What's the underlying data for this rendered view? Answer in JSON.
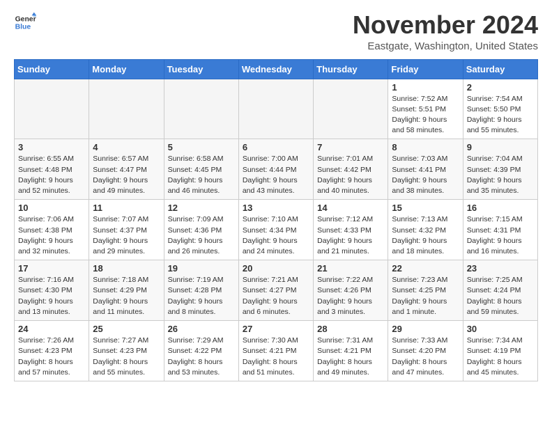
{
  "header": {
    "logo_general": "General",
    "logo_blue": "Blue",
    "month_title": "November 2024",
    "location": "Eastgate, Washington, United States"
  },
  "days_of_week": [
    "Sunday",
    "Monday",
    "Tuesday",
    "Wednesday",
    "Thursday",
    "Friday",
    "Saturday"
  ],
  "weeks": [
    [
      {
        "day": "",
        "detail": ""
      },
      {
        "day": "",
        "detail": ""
      },
      {
        "day": "",
        "detail": ""
      },
      {
        "day": "",
        "detail": ""
      },
      {
        "day": "",
        "detail": ""
      },
      {
        "day": "1",
        "detail": "Sunrise: 7:52 AM\nSunset: 5:51 PM\nDaylight: 9 hours and 58 minutes."
      },
      {
        "day": "2",
        "detail": "Sunrise: 7:54 AM\nSunset: 5:50 PM\nDaylight: 9 hours and 55 minutes."
      }
    ],
    [
      {
        "day": "3",
        "detail": "Sunrise: 6:55 AM\nSunset: 4:48 PM\nDaylight: 9 hours and 52 minutes."
      },
      {
        "day": "4",
        "detail": "Sunrise: 6:57 AM\nSunset: 4:47 PM\nDaylight: 9 hours and 49 minutes."
      },
      {
        "day": "5",
        "detail": "Sunrise: 6:58 AM\nSunset: 4:45 PM\nDaylight: 9 hours and 46 minutes."
      },
      {
        "day": "6",
        "detail": "Sunrise: 7:00 AM\nSunset: 4:44 PM\nDaylight: 9 hours and 43 minutes."
      },
      {
        "day": "7",
        "detail": "Sunrise: 7:01 AM\nSunset: 4:42 PM\nDaylight: 9 hours and 40 minutes."
      },
      {
        "day": "8",
        "detail": "Sunrise: 7:03 AM\nSunset: 4:41 PM\nDaylight: 9 hours and 38 minutes."
      },
      {
        "day": "9",
        "detail": "Sunrise: 7:04 AM\nSunset: 4:39 PM\nDaylight: 9 hours and 35 minutes."
      }
    ],
    [
      {
        "day": "10",
        "detail": "Sunrise: 7:06 AM\nSunset: 4:38 PM\nDaylight: 9 hours and 32 minutes."
      },
      {
        "day": "11",
        "detail": "Sunrise: 7:07 AM\nSunset: 4:37 PM\nDaylight: 9 hours and 29 minutes."
      },
      {
        "day": "12",
        "detail": "Sunrise: 7:09 AM\nSunset: 4:36 PM\nDaylight: 9 hours and 26 minutes."
      },
      {
        "day": "13",
        "detail": "Sunrise: 7:10 AM\nSunset: 4:34 PM\nDaylight: 9 hours and 24 minutes."
      },
      {
        "day": "14",
        "detail": "Sunrise: 7:12 AM\nSunset: 4:33 PM\nDaylight: 9 hours and 21 minutes."
      },
      {
        "day": "15",
        "detail": "Sunrise: 7:13 AM\nSunset: 4:32 PM\nDaylight: 9 hours and 18 minutes."
      },
      {
        "day": "16",
        "detail": "Sunrise: 7:15 AM\nSunset: 4:31 PM\nDaylight: 9 hours and 16 minutes."
      }
    ],
    [
      {
        "day": "17",
        "detail": "Sunrise: 7:16 AM\nSunset: 4:30 PM\nDaylight: 9 hours and 13 minutes."
      },
      {
        "day": "18",
        "detail": "Sunrise: 7:18 AM\nSunset: 4:29 PM\nDaylight: 9 hours and 11 minutes."
      },
      {
        "day": "19",
        "detail": "Sunrise: 7:19 AM\nSunset: 4:28 PM\nDaylight: 9 hours and 8 minutes."
      },
      {
        "day": "20",
        "detail": "Sunrise: 7:21 AM\nSunset: 4:27 PM\nDaylight: 9 hours and 6 minutes."
      },
      {
        "day": "21",
        "detail": "Sunrise: 7:22 AM\nSunset: 4:26 PM\nDaylight: 9 hours and 3 minutes."
      },
      {
        "day": "22",
        "detail": "Sunrise: 7:23 AM\nSunset: 4:25 PM\nDaylight: 9 hours and 1 minute."
      },
      {
        "day": "23",
        "detail": "Sunrise: 7:25 AM\nSunset: 4:24 PM\nDaylight: 8 hours and 59 minutes."
      }
    ],
    [
      {
        "day": "24",
        "detail": "Sunrise: 7:26 AM\nSunset: 4:23 PM\nDaylight: 8 hours and 57 minutes."
      },
      {
        "day": "25",
        "detail": "Sunrise: 7:27 AM\nSunset: 4:23 PM\nDaylight: 8 hours and 55 minutes."
      },
      {
        "day": "26",
        "detail": "Sunrise: 7:29 AM\nSunset: 4:22 PM\nDaylight: 8 hours and 53 minutes."
      },
      {
        "day": "27",
        "detail": "Sunrise: 7:30 AM\nSunset: 4:21 PM\nDaylight: 8 hours and 51 minutes."
      },
      {
        "day": "28",
        "detail": "Sunrise: 7:31 AM\nSunset: 4:21 PM\nDaylight: 8 hours and 49 minutes."
      },
      {
        "day": "29",
        "detail": "Sunrise: 7:33 AM\nSunset: 4:20 PM\nDaylight: 8 hours and 47 minutes."
      },
      {
        "day": "30",
        "detail": "Sunrise: 7:34 AM\nSunset: 4:19 PM\nDaylight: 8 hours and 45 minutes."
      }
    ]
  ]
}
